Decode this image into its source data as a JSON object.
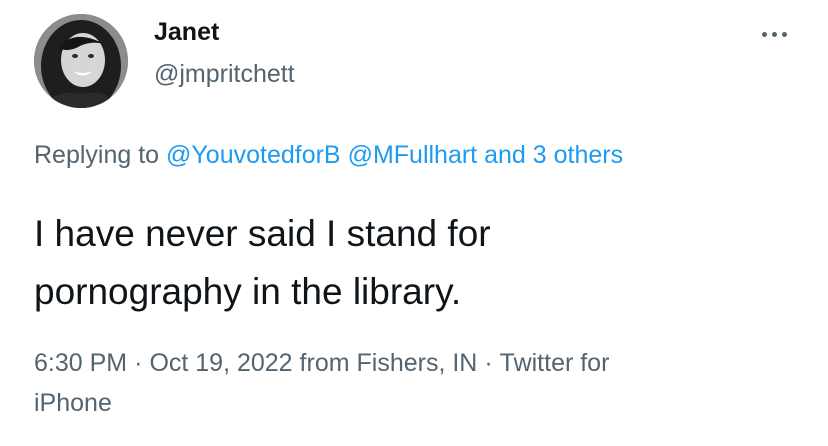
{
  "user": {
    "display_name": "Janet",
    "handle": "@jmpritchett"
  },
  "replying": {
    "prefix": "Replying to",
    "mentions": [
      "@YouvotedforB",
      "@MFullhart"
    ],
    "others": "and 3 others"
  },
  "tweet": {
    "text_lines": [
      "I have never said I stand for",
      "pornography in the library."
    ]
  },
  "meta": {
    "time": "6:30 PM",
    "separator": "·",
    "date": "Oct 19, 2022",
    "location": "from Fishers, IN",
    "source_line1": "Twitter for",
    "source_line2": "iPhone"
  },
  "icons": {
    "more": "more-horizontal-icon",
    "avatar": "user-avatar"
  },
  "colors": {
    "text_primary": "#0f1419",
    "text_secondary": "#536471",
    "link": "#1d9bf0",
    "background": "#ffffff"
  }
}
